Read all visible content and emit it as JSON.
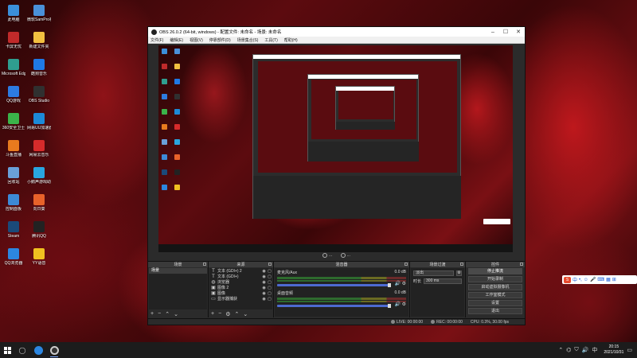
{
  "desktop": {
    "icons": [
      {
        "label": "此电脑",
        "icon": "computer-icon",
        "color": "#3b8fd9"
      },
      {
        "label": "微软SamPro机器",
        "icon": "app-icon",
        "color": "#4a90d9"
      },
      {
        "label": "卡屏无忧",
        "icon": "app-icon",
        "color": "#c02a2a"
      },
      {
        "label": "新建文件夹",
        "icon": "folder-icon",
        "color": "#f2c040"
      },
      {
        "label": "Microsoft Edge",
        "icon": "edge-icon",
        "color": "#2f9e8f"
      },
      {
        "label": "酷狗音乐",
        "icon": "music-icon",
        "color": "#1f79e6"
      },
      {
        "label": "QQ游戏",
        "icon": "game-icon",
        "color": "#2d7be0"
      },
      {
        "label": "OBS Studio",
        "icon": "obs-icon",
        "color": "#303030"
      },
      {
        "label": "360安全卫士",
        "icon": "shield-icon",
        "color": "#3bb34a"
      },
      {
        "label": "网易UU加速器",
        "icon": "app-icon",
        "color": "#1c8ad8"
      },
      {
        "label": "斗鱼直播",
        "icon": "app-icon",
        "color": "#e87a1e"
      },
      {
        "label": "网易云音乐",
        "icon": "music-icon",
        "color": "#d62b2b"
      },
      {
        "label": "回收站",
        "icon": "recycle-bin-icon",
        "color": "#6aa0d8"
      },
      {
        "label": "小鹅声游戏助手",
        "icon": "app-icon",
        "color": "#29a6e0"
      },
      {
        "label": "控制面板",
        "icon": "control-panel-icon",
        "color": "#3d8ad6"
      },
      {
        "label": "向日葵",
        "icon": "app-icon",
        "color": "#e8622a"
      },
      {
        "label": "Steam",
        "icon": "steam-icon",
        "color": "#1b4a7a"
      },
      {
        "label": "腾讯QQ",
        "icon": "qq-icon",
        "color": "#222"
      },
      {
        "label": "QQ浏览器",
        "icon": "browser-icon",
        "color": "#2c86e0"
      },
      {
        "label": "YY语音",
        "icon": "app-icon",
        "color": "#f0c020"
      }
    ]
  },
  "obs": {
    "title": "OBS 26.0.2 (64-bit, windows) - 配置文件: 未命名 - 场景: 未命名",
    "menu": [
      "文件(F)",
      "编辑(E)",
      "视图(V)",
      "停靠部件(D)",
      "场景集合(S)",
      "工具(T)",
      "帮助(H)"
    ],
    "preview_controls": {
      "studio_mode": "...",
      "record_label": "..."
    },
    "docks": {
      "scenes": {
        "title": "场景",
        "items": [
          "场景"
        ]
      },
      "sources": {
        "title": "来源",
        "items": [
          {
            "name": "文本 (GDI+) 2",
            "icon": "T"
          },
          {
            "name": "文本 (GDI+)",
            "icon": "T"
          },
          {
            "name": "浏览器",
            "icon": "◍"
          },
          {
            "name": "图像 2",
            "icon": "▣"
          },
          {
            "name": "图像",
            "icon": "▣"
          },
          {
            "name": "显示器捕获",
            "icon": "▭"
          }
        ]
      },
      "mixer": {
        "title": "混音器",
        "tracks": [
          {
            "name": "麦克风/Aux",
            "level": "0.0 dB",
            "volume": 1.0
          },
          {
            "name": "桌面音频",
            "level": "0.0 dB",
            "volume": 1.0
          }
        ]
      },
      "transitions": {
        "title": "场景过渡",
        "type": "淡出",
        "duration_label": "时长",
        "duration": "300 ms"
      },
      "controls": {
        "title": "控件",
        "buttons": [
          "停止推流",
          "开始录制",
          "启动虚拟摄像机",
          "工作室模式",
          "设置",
          "退出"
        ]
      }
    },
    "status": {
      "live": "LIVE: 00:00:00",
      "rec": "REC: 00:00:00",
      "cpu": "CPU: 0.3%, 30.00 fps"
    }
  },
  "ime": {
    "lang": "中"
  },
  "taskbar": {
    "time": "20:15",
    "date": "2021/10/31"
  }
}
